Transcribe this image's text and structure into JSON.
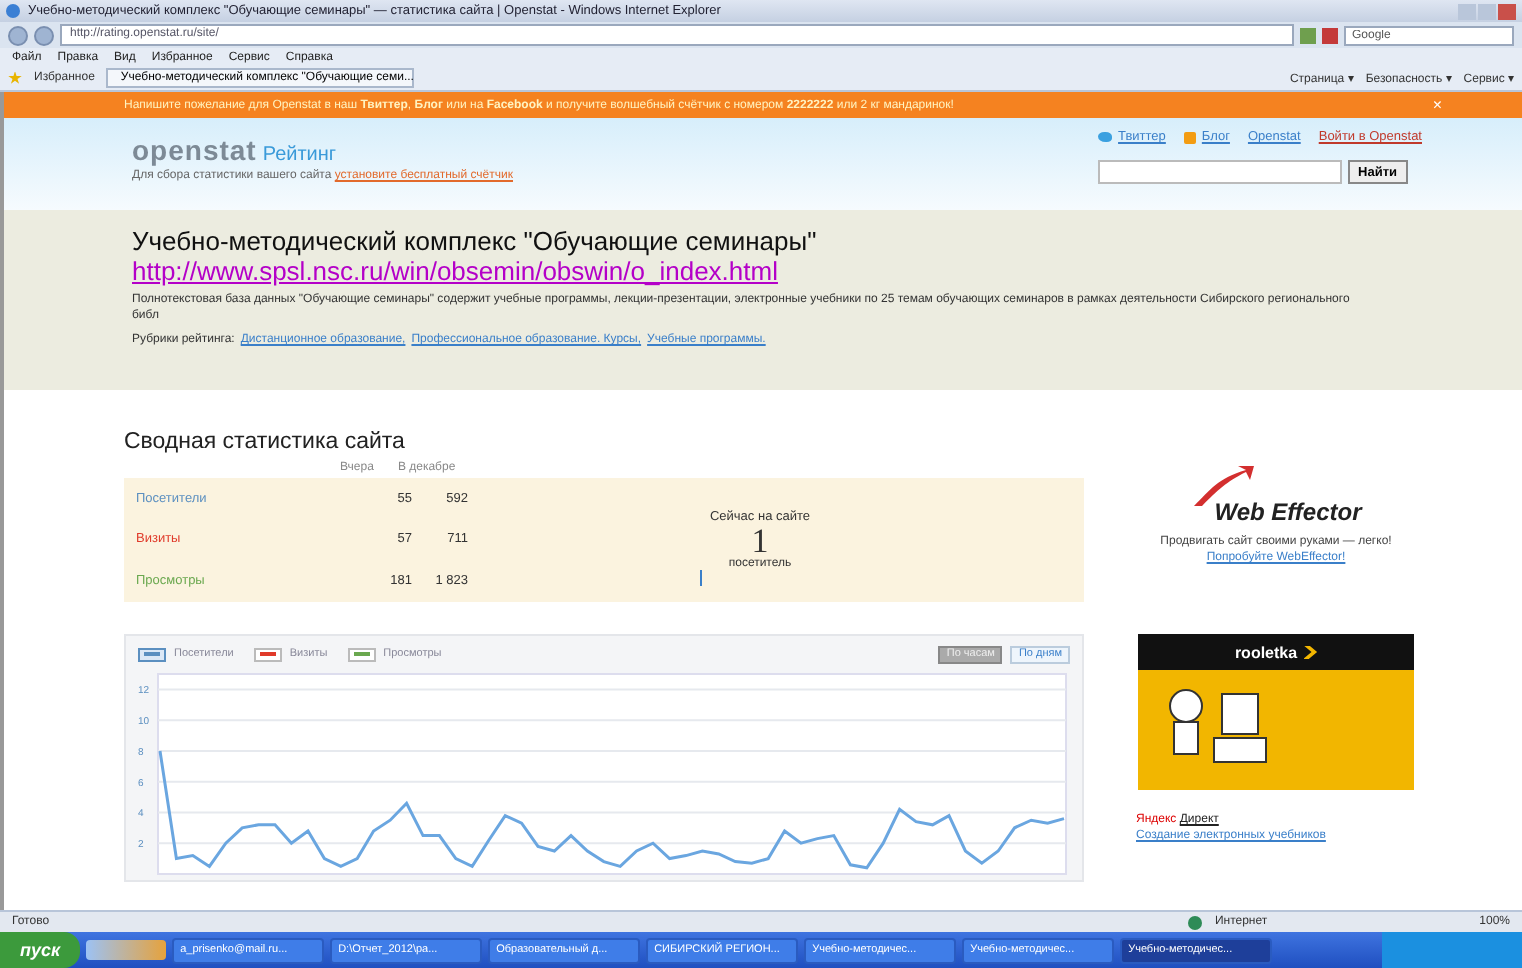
{
  "window": {
    "title": "Учебно-методический комплекс \"Обучающие семинары\" — статистика сайта | Openstat - Windows Internet Explorer"
  },
  "address_bar": {
    "url": "http://rating.openstat.ru/site/",
    "search_placeholder": "Google"
  },
  "menu": [
    "Файл",
    "Правка",
    "Вид",
    "Избранное",
    "Сервис",
    "Справка"
  ],
  "favorites_bar": {
    "favorites": "Избранное",
    "tab": "Учебно-методический комплекс \"Обучающие семи...",
    "commands": [
      "Страница ▾",
      "Безопасность ▾",
      "Сервис ▾"
    ]
  },
  "banner": {
    "text": "Напишите пожелание для Openstat в наш **Твиттер**, **Блог** или на **Facebook** и получите волшебный счётчик с номером **2222222** или 2 кг мандаринок!",
    "close": "×"
  },
  "header": {
    "logo": "openstat",
    "logo_suffix": "Рейтинг",
    "tagline": "Для сбора статистики вашего сайта",
    "tagline_link": "установите бесплатный счётчик",
    "links": [
      {
        "label": "Твиттер",
        "kind": "twitter"
      },
      {
        "label": "Блог",
        "kind": "blog"
      },
      {
        "label": "Openstat",
        "kind": "plain"
      },
      {
        "label": "Войти в Openstat",
        "kind": "login"
      }
    ],
    "search_button": "Найти"
  },
  "site": {
    "title": "Учебно-методический комплекс \"Обучающие семинары\"",
    "url": "http://www.spsl.nsc.ru/win/obsemin/obswin/o_index.html",
    "description": "Полнотекстовая база данных \"Обучающие семинары\" содержит учебные программы, лекции-презентации, электронные учебники по 25 темам обучающих семинаров в рамках деятельности Сибирского регионального библ",
    "categories_label": "Рубрики рейтинга:",
    "categories": [
      "Дистанционное образование,",
      "Профессиональное образование. Курсы,",
      "Учебные программы."
    ]
  },
  "stats": {
    "title": "Сводная статистика сайта",
    "columns": [
      "Вчера",
      "В декабре"
    ],
    "rows": [
      {
        "label": "Посетители",
        "color": "#5b8fc0",
        "values": [
          "55",
          "592"
        ]
      },
      {
        "label": "Визиты",
        "color": "#e03a2a",
        "values": [
          "57",
          "711"
        ]
      },
      {
        "label": "Просмотры",
        "color": "#6aa84f",
        "values": [
          "181",
          "1 823"
        ]
      }
    ],
    "online": {
      "label": "Сейчас на сайте",
      "count": "1",
      "unit": "посетитель"
    }
  },
  "chart": {
    "legend": [
      {
        "label": "Посетители",
        "color": "#5b8fc0",
        "selected": true
      },
      {
        "label": "Визиты",
        "color": "#e03a2a",
        "selected": false
      },
      {
        "label": "Просмотры",
        "color": "#6aa84f",
        "selected": false
      }
    ],
    "modes": [
      {
        "label": "По часам",
        "selected": true
      },
      {
        "label": "По дням",
        "selected": false
      }
    ],
    "chart_data": {
      "type": "line",
      "ylim": [
        0,
        13
      ],
      "yticks": [
        2,
        4,
        6,
        8,
        10,
        12
      ],
      "grid": true,
      "series": [
        {
          "color": "#6aa6e0",
          "values": [
            8,
            1,
            1.2,
            0.5,
            2,
            3,
            3.2,
            3.2,
            2,
            2.8,
            1,
            0.5,
            1,
            2.8,
            3.5,
            4.6,
            2.5,
            2.5,
            1,
            0.5,
            2.2,
            3.8,
            3.3,
            1.8,
            1.5,
            2.5,
            1.5,
            0.8,
            0.5,
            1.5,
            2,
            1,
            1.2,
            1.5,
            1.3,
            0.8,
            0.7,
            1,
            2.8,
            2,
            2.3,
            2.5,
            0.6,
            0.4,
            2,
            4.2,
            3.4,
            3.2,
            3.8,
            1.5,
            0.7,
            1.5,
            3,
            3.5,
            3.3,
            3.6
          ]
        }
      ]
    }
  },
  "sidebar": {
    "webeffector": {
      "logo": "Web Effector",
      "text": "Продвигать сайт своими руками — легко!",
      "link": "Попробуйте WebEffector!"
    },
    "ad": {
      "logo": "rooletka"
    },
    "direct": {
      "label": "Яндекс",
      "link": "Директ",
      "item": "Создание электронных учебников"
    }
  },
  "status_bar": {
    "text": "Готово",
    "zone": "Интернет",
    "zoom": "100%"
  },
  "taskbar": {
    "start": "пуск",
    "items": [
      {
        "label": "a_prisenko@mail.ru...",
        "selected": false
      },
      {
        "label": "D:\\Отчет_2012\\ра...",
        "selected": false
      },
      {
        "label": "Образовательный д...",
        "selected": false
      },
      {
        "label": "СИБИРСКИЙ РЕГИОН...",
        "selected": false
      },
      {
        "label": "Учебно-методичес...",
        "selected": false
      },
      {
        "label": "Учебно-методичес...",
        "selected": false
      },
      {
        "label": "Учебно-методичес...",
        "selected": true
      }
    ]
  }
}
